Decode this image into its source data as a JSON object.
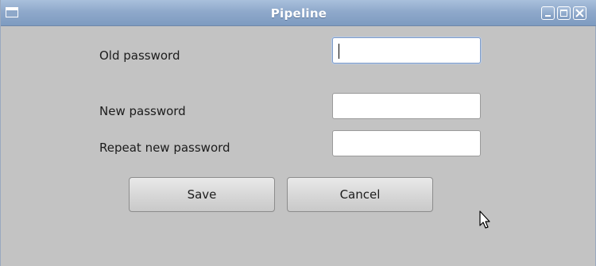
{
  "window": {
    "title": "Pipeline",
    "icon": "window-menu-icon",
    "controls": [
      "minimize-icon",
      "maximize-icon",
      "close-icon"
    ]
  },
  "form": {
    "old_password": {
      "label": "Old password",
      "value": "",
      "placeholder": ""
    },
    "new_password": {
      "label": "New password",
      "value": "",
      "placeholder": ""
    },
    "repeat_password": {
      "label": "Repeat new password",
      "value": "",
      "placeholder": ""
    }
  },
  "buttons": {
    "save": "Save",
    "cancel": "Cancel"
  },
  "colors": {
    "titlebar": "#8fa9cb",
    "window_bg": "#c3c3c3",
    "focus_border": "#7f9cc7"
  }
}
